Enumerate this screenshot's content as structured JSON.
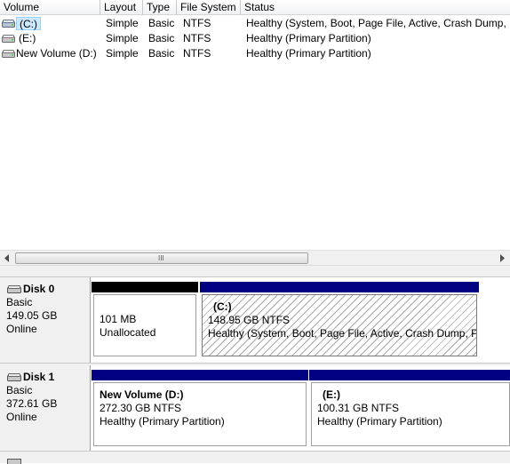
{
  "columns": [
    "Volume",
    "Layout",
    "Type",
    "File System",
    "Status"
  ],
  "volumes": [
    {
      "name": "(C:)",
      "layout": "Simple",
      "type": "Basic",
      "fs": "NTFS",
      "status": "Healthy (System, Boot, Page File, Active, Crash Dump, Pr",
      "selected": true
    },
    {
      "name": "(E:)",
      "layout": "Simple",
      "type": "Basic",
      "fs": "NTFS",
      "status": "Healthy (Primary Partition)",
      "selected": false
    },
    {
      "name": "New Volume (D:)",
      "layout": "Simple",
      "type": "Basic",
      "fs": "NTFS",
      "status": "Healthy (Primary Partition)",
      "selected": false
    }
  ],
  "scrollbar": {
    "grip": "III"
  },
  "disks": [
    {
      "name": "Disk 0",
      "type": "Basic",
      "size": "149.05 GB",
      "state": "Online",
      "partitions": [
        {
          "title": "",
          "size": "101 MB",
          "detail": "Unallocated",
          "bar_color": "#000000",
          "hatched": false
        },
        {
          "title": "(C:)",
          "size": "148.95 GB NTFS",
          "detail": "Healthy (System, Boot, Page File, Active, Crash Dump, Pri",
          "bar_color": "#000080",
          "hatched": true
        }
      ]
    },
    {
      "name": "Disk 1",
      "type": "Basic",
      "size": "372.61 GB",
      "state": "Online",
      "partitions": [
        {
          "title": "New Volume  (D:)",
          "size": "272.30 GB NTFS",
          "detail": "Healthy (Primary Partition)",
          "bar_color": "#000080",
          "hatched": false
        },
        {
          "title": "(E:)",
          "size": "100.31 GB NTFS",
          "detail": "Healthy (Primary Partition)",
          "bar_color": "#000080",
          "hatched": false
        }
      ]
    }
  ],
  "colors": {
    "primary_partition_bar": "#000080",
    "unallocated_bar": "#000000",
    "selection": "#cce8ff"
  }
}
